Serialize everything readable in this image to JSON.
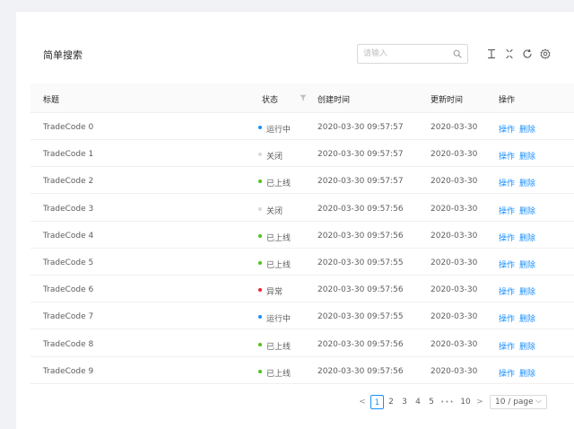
{
  "toolbar": {
    "title": "简单搜索",
    "search_placeholder": "请输入"
  },
  "columns": {
    "title": "标题",
    "status": "状态",
    "created": "创建时间",
    "updated": "更新时间",
    "actions": "操作"
  },
  "status_colors": {
    "运行中": "#1890ff",
    "关闭": "#d9d9d9",
    "已上线": "#52c41a",
    "异常": "#f5222d"
  },
  "rows": [
    {
      "title": "TradeCode 0",
      "status": "运行中",
      "created": "2020-03-30 09:57:57",
      "updated": "2020-03-30",
      "op": "操作",
      "del": "删除"
    },
    {
      "title": "TradeCode 1",
      "status": "关闭",
      "created": "2020-03-30 09:57:57",
      "updated": "2020-03-30",
      "op": "操作",
      "del": "删除"
    },
    {
      "title": "TradeCode 2",
      "status": "已上线",
      "created": "2020-03-30 09:57:57",
      "updated": "2020-03-30",
      "op": "操作",
      "del": "删除"
    },
    {
      "title": "TradeCode 3",
      "status": "关闭",
      "created": "2020-03-30 09:57:56",
      "updated": "2020-03-30",
      "op": "操作",
      "del": "删除"
    },
    {
      "title": "TradeCode 4",
      "status": "已上线",
      "created": "2020-03-30 09:57:56",
      "updated": "2020-03-30",
      "op": "操作",
      "del": "删除"
    },
    {
      "title": "TradeCode 5",
      "status": "已上线",
      "created": "2020-03-30 09:57:55",
      "updated": "2020-03-30",
      "op": "操作",
      "del": "删除"
    },
    {
      "title": "TradeCode 6",
      "status": "异常",
      "created": "2020-03-30 09:57:56",
      "updated": "2020-03-30",
      "op": "操作",
      "del": "删除"
    },
    {
      "title": "TradeCode 7",
      "status": "运行中",
      "created": "2020-03-30 09:57:55",
      "updated": "2020-03-30",
      "op": "操作",
      "del": "删除"
    },
    {
      "title": "TradeCode 8",
      "status": "已上线",
      "created": "2020-03-30 09:57:56",
      "updated": "2020-03-30",
      "op": "操作",
      "del": "删除"
    },
    {
      "title": "TradeCode 9",
      "status": "已上线",
      "created": "2020-03-30 09:57:56",
      "updated": "2020-03-30",
      "op": "操作",
      "del": "删除"
    }
  ],
  "pagination": {
    "prev": "<",
    "pages": [
      "1",
      "2",
      "3",
      "4",
      "5"
    ],
    "ellipsis": "•••",
    "last": "10",
    "next": ">",
    "current": "1",
    "page_size": "10 / page"
  }
}
